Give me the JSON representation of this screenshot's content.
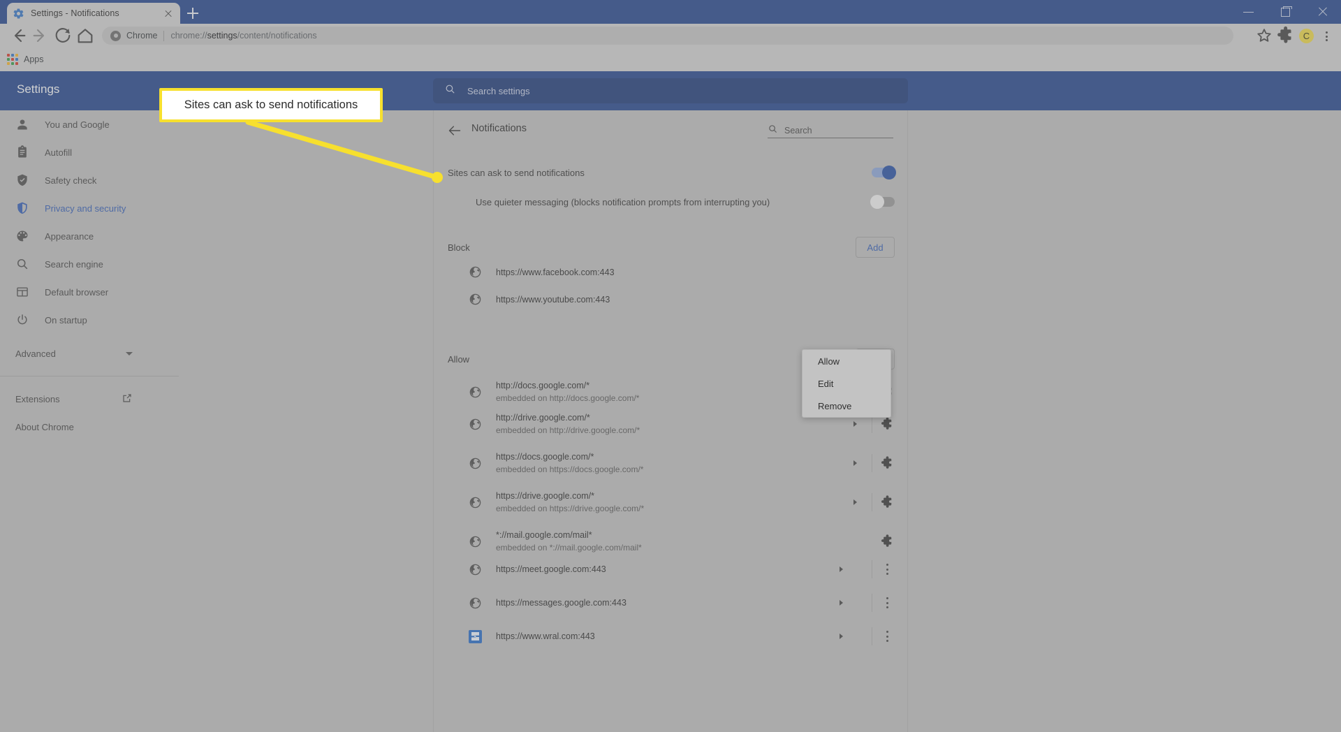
{
  "browser": {
    "tab": {
      "title": "Settings - Notifications",
      "favicon": "gear-icon",
      "close": "×"
    },
    "newtab_label": "+",
    "omnibox": {
      "scheme_chip": "Chrome",
      "url_prefix": "chrome://",
      "url_bold": "settings",
      "url_suffix": "/content/notifications",
      "full_url": "chrome://settings/content/notifications"
    },
    "bookmarks": {
      "apps_label": "Apps"
    },
    "profile_initial": "C",
    "window_controls": {
      "minimize": "minimize-icon",
      "maximize": "restore-icon",
      "close": "close-icon"
    }
  },
  "settings": {
    "header_title": "Settings",
    "search_placeholder": "Search settings",
    "sidebar": {
      "items": [
        {
          "label": "You and Google",
          "icon": "person-icon",
          "active": false
        },
        {
          "label": "Autofill",
          "icon": "clipboard-icon",
          "active": false
        },
        {
          "label": "Safety check",
          "icon": "shield-check-icon",
          "active": false
        },
        {
          "label": "Privacy and security",
          "icon": "shield-icon",
          "active": true
        },
        {
          "label": "Appearance",
          "icon": "palette-icon",
          "active": false
        },
        {
          "label": "Search engine",
          "icon": "search-icon",
          "active": false
        },
        {
          "label": "Default browser",
          "icon": "browser-window-icon",
          "active": false
        },
        {
          "label": "On startup",
          "icon": "power-icon",
          "active": false
        }
      ],
      "advanced_label": "Advanced",
      "extensions_label": "Extensions",
      "about_label": "About Chrome"
    },
    "page": {
      "title": "Notifications",
      "search_placeholder": "Search",
      "toggles": [
        {
          "label": "Sites can ask to send notifications",
          "state": "on"
        },
        {
          "label": "Use quieter messaging (blocks notification prompts from interrupting you)",
          "state": "off"
        }
      ],
      "block": {
        "title": "Block",
        "add_label": "Add",
        "sites": [
          {
            "url": "https://www.facebook.com:443",
            "sub": "",
            "icon": "globe-icon",
            "action": "none"
          },
          {
            "url": "https://www.youtube.com:443",
            "sub": "",
            "icon": "globe-icon",
            "action": "none"
          }
        ]
      },
      "allow": {
        "title": "Allow",
        "add_label": "Add",
        "sites": [
          {
            "url": "http://docs.google.com/*",
            "sub": "embedded on http://docs.google.com/*",
            "icon": "globe-icon",
            "action": "puzzle-icon",
            "chevron": true
          },
          {
            "url": "http://drive.google.com/*",
            "sub": "embedded on http://drive.google.com/*",
            "icon": "globe-icon",
            "action": "puzzle-icon",
            "chevron": true
          },
          {
            "url": "https://docs.google.com/*",
            "sub": "embedded on https://docs.google.com/*",
            "icon": "globe-icon",
            "action": "puzzle-icon",
            "chevron": true
          },
          {
            "url": "https://drive.google.com/*",
            "sub": "embedded on https://drive.google.com/*",
            "icon": "globe-icon",
            "action": "puzzle-icon",
            "chevron": true
          },
          {
            "url": "*://mail.google.com/mail*",
            "sub": "embedded on *://mail.google.com/mail*",
            "icon": "globe-icon",
            "action": "puzzle-icon",
            "chevron": false
          },
          {
            "url": "https://meet.google.com:443",
            "sub": "",
            "icon": "globe-icon",
            "action": "kebab-icon",
            "chevron": true
          },
          {
            "url": "https://messages.google.com:443",
            "sub": "",
            "icon": "globe-icon",
            "action": "kebab-icon",
            "chevron": true
          },
          {
            "url": "https://www.wral.com:443",
            "sub": "",
            "icon": "wral-favicon",
            "action": "kebab-icon",
            "chevron": true
          }
        ]
      },
      "context_menu": {
        "items": [
          "Allow",
          "Edit",
          "Remove"
        ]
      }
    }
  },
  "annotation": {
    "callout_text": "Sites can ask to send notifications",
    "border_color": "#f7e02e",
    "line_color": "#f7e02e"
  }
}
